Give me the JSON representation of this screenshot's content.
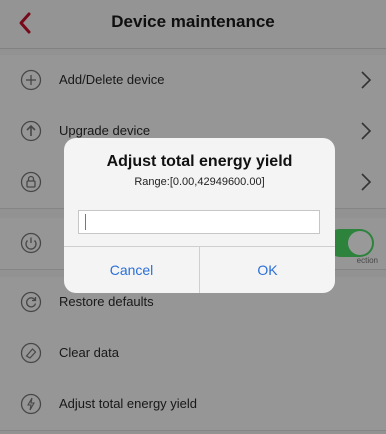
{
  "header": {
    "title": "Device maintenance",
    "back_icon": "chevron-left-icon",
    "accent_color": "#c8102e"
  },
  "list": {
    "items": [
      {
        "label": "Add/Delete device",
        "icon": "plus-circle-icon"
      },
      {
        "label": "Upgrade device",
        "icon": "upload-circle-icon"
      },
      {
        "label": "",
        "icon": "lock-circle-icon"
      },
      {
        "label": "",
        "icon": "power-circle-icon"
      },
      {
        "label": "Restore defaults",
        "icon": "restore-circle-icon"
      },
      {
        "label": "Clear data",
        "icon": "eraser-circle-icon"
      },
      {
        "label": "Adjust total energy yield",
        "icon": "energy-circle-icon"
      }
    ],
    "toggle_on_color": "#4cd964",
    "toggle_hint": "ection"
  },
  "dialog": {
    "title": "Adjust total energy yield",
    "range": "Range:[0.00,42949600.00]",
    "input_value": "",
    "cancel_label": "Cancel",
    "ok_label": "OK"
  }
}
